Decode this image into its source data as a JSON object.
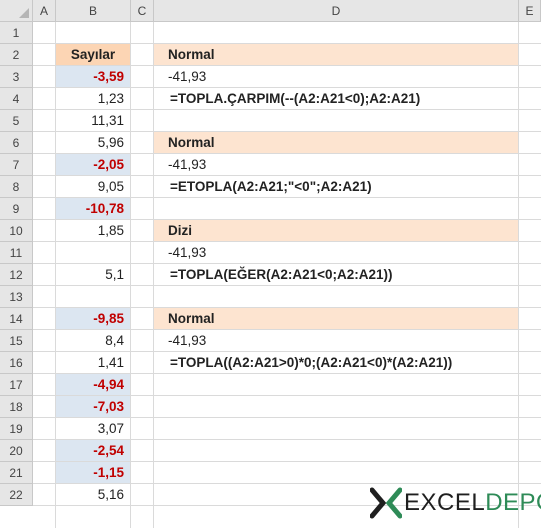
{
  "columns": [
    "A",
    "B",
    "C",
    "D",
    "E"
  ],
  "rows": [
    "1",
    "2",
    "3",
    "4",
    "5",
    "6",
    "7",
    "8",
    "9",
    "10",
    "11",
    "12",
    "13",
    "14",
    "15",
    "16",
    "17",
    "18",
    "19",
    "20",
    "21",
    "22"
  ],
  "column_b": {
    "header": "Sayılar",
    "values": [
      {
        "row": 3,
        "text": "-3,59",
        "negative": true
      },
      {
        "row": 4,
        "text": "1,23",
        "negative": false
      },
      {
        "row": 5,
        "text": "11,31",
        "negative": false
      },
      {
        "row": 6,
        "text": "5,96",
        "negative": false
      },
      {
        "row": 7,
        "text": "-2,05",
        "negative": true
      },
      {
        "row": 8,
        "text": "9,05",
        "negative": false
      },
      {
        "row": 9,
        "text": "-10,78",
        "negative": true
      },
      {
        "row": 10,
        "text": "1,85",
        "negative": false
      },
      {
        "row": 11,
        "text": "",
        "negative": false
      },
      {
        "row": 12,
        "text": "5,1",
        "negative": false
      },
      {
        "row": 13,
        "text": "",
        "negative": false
      },
      {
        "row": 14,
        "text": "-9,85",
        "negative": true
      },
      {
        "row": 15,
        "text": "8,4",
        "negative": false
      },
      {
        "row": 16,
        "text": "1,41",
        "negative": false
      },
      {
        "row": 17,
        "text": "-4,94",
        "negative": true
      },
      {
        "row": 18,
        "text": "-7,03",
        "negative": true
      },
      {
        "row": 19,
        "text": "3,07",
        "negative": false
      },
      {
        "row": 20,
        "text": "-2,54",
        "negative": true
      },
      {
        "row": 21,
        "text": "-1,15",
        "negative": true
      },
      {
        "row": 22,
        "text": "5,16",
        "negative": false
      }
    ]
  },
  "column_d": [
    {
      "row": 2,
      "text": "Normal",
      "kind": "header"
    },
    {
      "row": 3,
      "text": "-41,93",
      "kind": "value"
    },
    {
      "row": 4,
      "text": "=TOPLA.ÇARPIM(--(A2:A21<0);A2:A21)",
      "kind": "formula"
    },
    {
      "row": 6,
      "text": "Normal",
      "kind": "header"
    },
    {
      "row": 7,
      "text": "-41,93",
      "kind": "value"
    },
    {
      "row": 8,
      "text": "=ETOPLA(A2:A21;\"<0\";A2:A21)",
      "kind": "formula"
    },
    {
      "row": 10,
      "text": "Dizi",
      "kind": "header"
    },
    {
      "row": 11,
      "text": "-41,93",
      "kind": "value"
    },
    {
      "row": 12,
      "text": "=TOPLA(EĞER(A2:A21<0;A2:A21))",
      "kind": "formula"
    },
    {
      "row": 14,
      "text": "Normal",
      "kind": "header"
    },
    {
      "row": 15,
      "text": "-41,93",
      "kind": "value"
    },
    {
      "row": 16,
      "text": "=TOPLA((A2:A21>0)*0;(A2:A21<0)*(A2:A21))",
      "kind": "formula"
    }
  ],
  "colors": {
    "header_fill_b": "#fcd5b4",
    "negative_fill": "#dce6f1",
    "header_fill_d": "#fde4d0",
    "negative_text": "#c00000"
  },
  "logo": {
    "part1": "EXCEL",
    "part2": "DEPO",
    "icon": "x-logo-icon"
  }
}
